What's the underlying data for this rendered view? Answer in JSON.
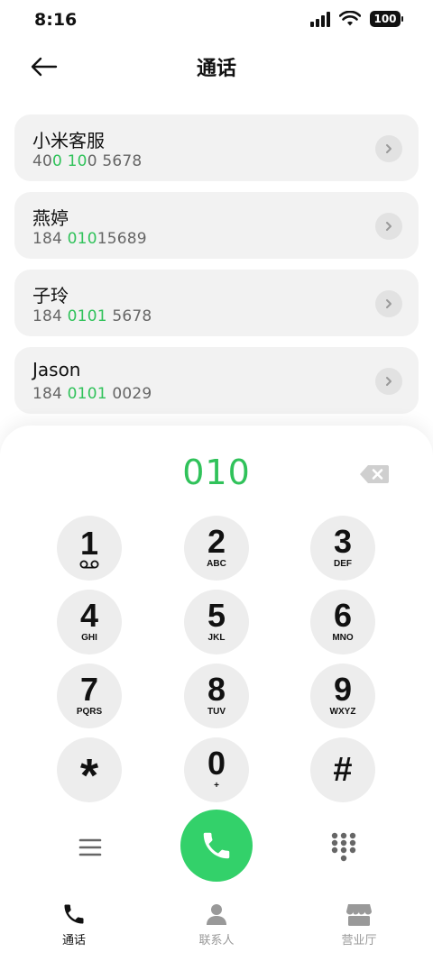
{
  "status_bar": {
    "time": "8:16",
    "battery": "100"
  },
  "header": {
    "title": "通话"
  },
  "contacts": [
    {
      "name": "小米客服",
      "number_parts": [
        "40",
        "0 10",
        "0 5678"
      ]
    },
    {
      "name": "燕婷",
      "number_parts": [
        "184 ",
        "010",
        "15689"
      ]
    },
    {
      "name": "子玲",
      "number_parts": [
        "184 ",
        "0101",
        " 5678"
      ]
    },
    {
      "name": "Jason",
      "number_parts": [
        "184 ",
        "0101",
        " 0029"
      ]
    }
  ],
  "dialer": {
    "input": "010",
    "keys": [
      {
        "digit": "1",
        "letters": ""
      },
      {
        "digit": "2",
        "letters": "ABC"
      },
      {
        "digit": "3",
        "letters": "DEF"
      },
      {
        "digit": "4",
        "letters": "GHI"
      },
      {
        "digit": "5",
        "letters": "JKL"
      },
      {
        "digit": "6",
        "letters": "MNO"
      },
      {
        "digit": "7",
        "letters": "PQRS"
      },
      {
        "digit": "8",
        "letters": "TUV"
      },
      {
        "digit": "9",
        "letters": "WXYZ"
      },
      {
        "digit": "*",
        "letters": ""
      },
      {
        "digit": "0",
        "letters": "+"
      },
      {
        "digit": "#",
        "letters": ""
      }
    ]
  },
  "tabs": [
    {
      "label": "通话",
      "icon": "phone-icon",
      "active": true
    },
    {
      "label": "联系人",
      "icon": "person-icon",
      "active": false
    },
    {
      "label": "营业厅",
      "icon": "store-icon",
      "active": false
    }
  ],
  "colors": {
    "accent": "#30c25a",
    "call_button": "#33d16a",
    "card_bg": "#f2f2f2",
    "key_bg": "#ededed"
  }
}
